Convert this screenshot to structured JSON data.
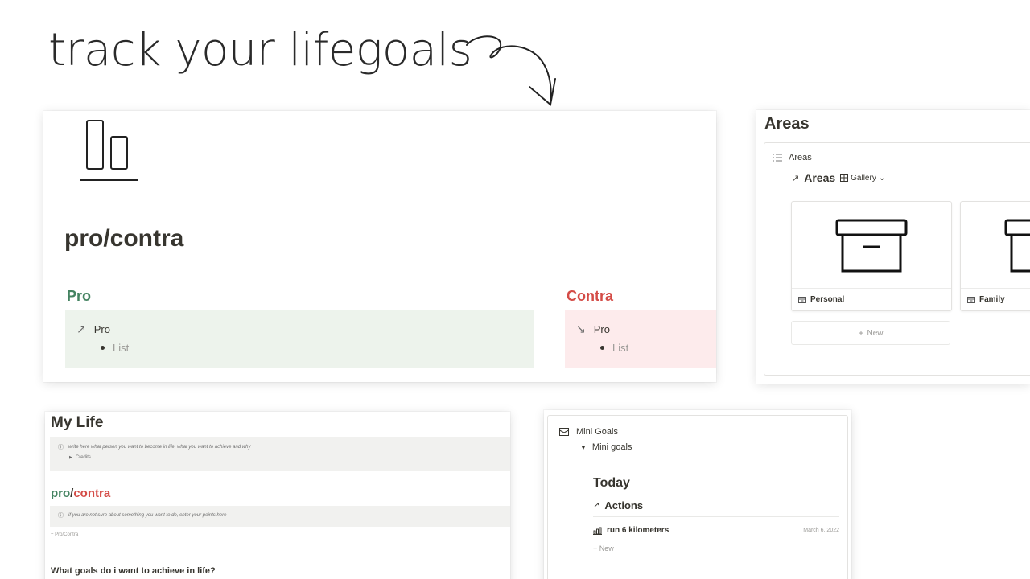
{
  "headline": "track your lifegoals",
  "procontra": {
    "title": "pro/contra",
    "pro_heading": "Pro",
    "contra_heading": "Contra",
    "pro_box_label": "Pro",
    "pro_box_item": "List",
    "contra_box_label": "Pro",
    "contra_box_item": "List",
    "pro_arrow": "↗",
    "contra_arrow": "↘"
  },
  "areas": {
    "title": "Areas",
    "db_label": "Areas",
    "view_arrow": "↗",
    "view_name": "Areas",
    "view_type": "Gallery",
    "view_chevron": "⌄",
    "cards": [
      {
        "label": "Personal"
      },
      {
        "label": "Family"
      }
    ],
    "new_label": "New",
    "plus": "+"
  },
  "mylife": {
    "title": "My Life",
    "callout1": "write here what person you want to become in life, what you want to achieve and why",
    "credits": "Credits",
    "pc_pro": "pro",
    "pc_slash": "/",
    "pc_contra": "contra",
    "callout2": "if you are not sure about something you want to do, enter your points here",
    "add_pc": "+ Pro/Contra",
    "goals_question": "What goals do i want to achieve in life?"
  },
  "minigoals": {
    "db_label": "Mini Goals",
    "toggle": "Mini goals",
    "section": "Today",
    "view_arrow": "↗",
    "view_name": "Actions",
    "row_name": "run 6 kilometers",
    "row_date": "March 6, 2022",
    "new_label": "+ New"
  }
}
